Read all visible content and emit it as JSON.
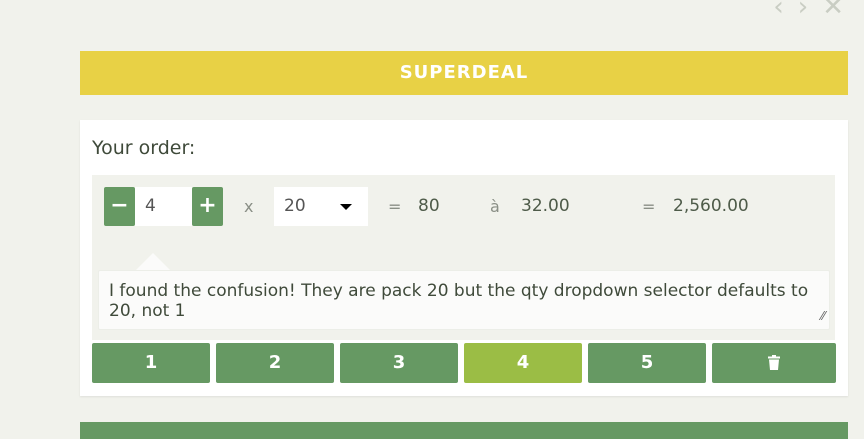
{
  "nav": {
    "prev_icon": "chevron-left-icon",
    "next_icon": "chevron-right-icon",
    "close_icon": "close-icon"
  },
  "banner": {
    "title": "SUPERDEAL"
  },
  "order": {
    "label": "Your order:",
    "minus_label": "−",
    "plus_label": "+",
    "quantity": "4",
    "times_symbol": "x",
    "pack_size": "20",
    "equals_symbol": "=",
    "subtotal_units": "80",
    "at_symbol": "à",
    "unit_price": "32.00",
    "total": "2,560.00"
  },
  "note": {
    "text": "I found the confusion! They are pack 20 but the qty dropdown selector defaults to 20, not 1"
  },
  "pages": [
    {
      "label": "1"
    },
    {
      "label": "2"
    },
    {
      "label": "3"
    },
    {
      "label": "4",
      "active": true
    },
    {
      "label": "5"
    }
  ],
  "delete_icon": "trash-icon",
  "colors": {
    "banner": "#e8d145",
    "button_green": "#669963",
    "active_page": "#9bbd45"
  }
}
